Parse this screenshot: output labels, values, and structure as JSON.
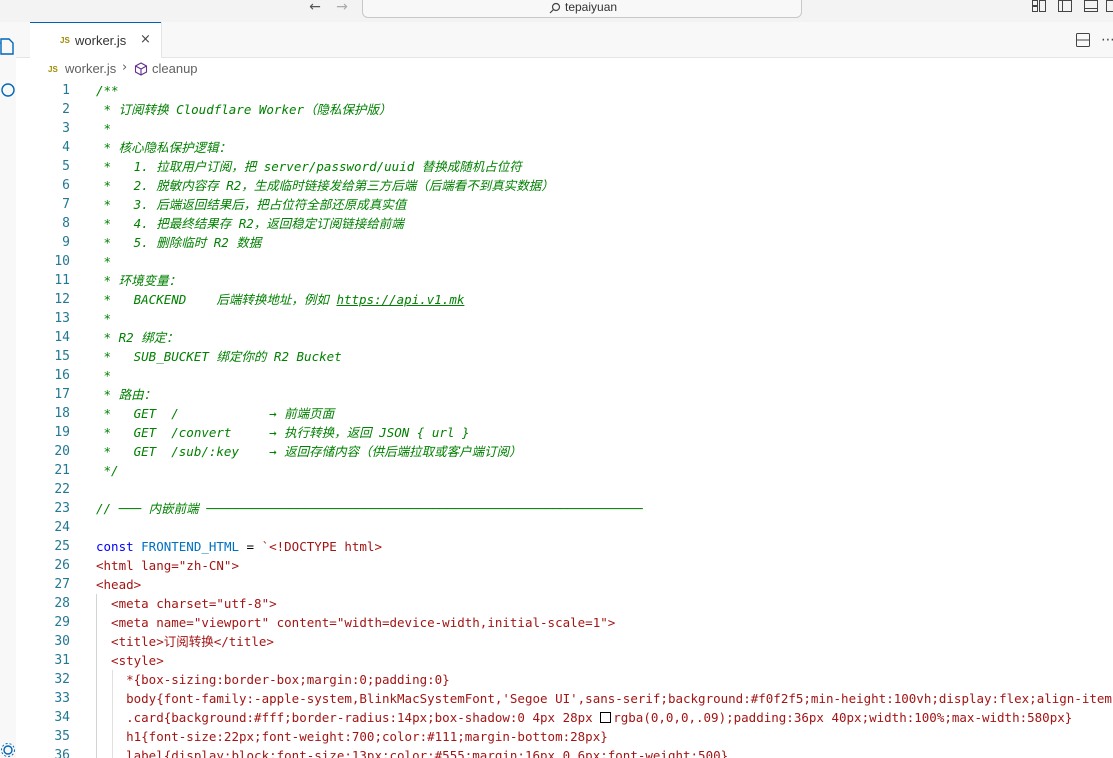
{
  "titlebar": {
    "back_icon": "arrow-left-icon",
    "forward_icon": "arrow-right-icon",
    "search_text": "tepaiyuan"
  },
  "tab": {
    "badge": "JS",
    "label": "worker.js",
    "close": "×"
  },
  "breadcrumb": {
    "badge": "JS",
    "file": "worker.js",
    "separator": "›",
    "symbol": "cleanup"
  },
  "editor": {
    "lines": [
      {
        "n": "1",
        "parts": [
          {
            "t": "/**",
            "c": "cm"
          }
        ]
      },
      {
        "n": "2",
        "parts": [
          {
            "t": " * 订阅转换 Cloudflare Worker（隐私保护版）",
            "c": "cm"
          }
        ]
      },
      {
        "n": "3",
        "parts": [
          {
            "t": " *",
            "c": "cm"
          }
        ]
      },
      {
        "n": "4",
        "parts": [
          {
            "t": " * 核心隐私保护逻辑：",
            "c": "cm"
          }
        ]
      },
      {
        "n": "5",
        "parts": [
          {
            "t": " *   1. 拉取用户订阅，把 server/password/uuid 替换成随机占位符",
            "c": "cm"
          }
        ]
      },
      {
        "n": "6",
        "parts": [
          {
            "t": " *   2. 脱敏内容存 R2，生成临时链接发给第三方后端（后端看不到真实数据）",
            "c": "cm"
          }
        ]
      },
      {
        "n": "7",
        "parts": [
          {
            "t": " *   3. 后端返回结果后，把占位符全部还原成真实值",
            "c": "cm"
          }
        ]
      },
      {
        "n": "8",
        "parts": [
          {
            "t": " *   4. 把最终结果存 R2，返回稳定订阅链接给前端",
            "c": "cm"
          }
        ]
      },
      {
        "n": "9",
        "parts": [
          {
            "t": " *   5. 删除临时 R2 数据",
            "c": "cm"
          }
        ]
      },
      {
        "n": "10",
        "parts": [
          {
            "t": " *",
            "c": "cm"
          }
        ]
      },
      {
        "n": "11",
        "parts": [
          {
            "t": " * 环境变量：",
            "c": "cm"
          }
        ]
      },
      {
        "n": "12",
        "parts": [
          {
            "t": " *   BACKEND    后端转换地址，例如 ",
            "c": "cm"
          },
          {
            "t": "https://api.v1.mk",
            "c": "cm link"
          }
        ]
      },
      {
        "n": "13",
        "parts": [
          {
            "t": " *",
            "c": "cm"
          }
        ]
      },
      {
        "n": "14",
        "parts": [
          {
            "t": " * R2 绑定：",
            "c": "cm"
          }
        ]
      },
      {
        "n": "15",
        "parts": [
          {
            "t": " *   SUB_BUCKET 绑定你的 R2 Bucket",
            "c": "cm"
          }
        ]
      },
      {
        "n": "16",
        "parts": [
          {
            "t": " *",
            "c": "cm"
          }
        ]
      },
      {
        "n": "17",
        "parts": [
          {
            "t": " * 路由：",
            "c": "cm"
          }
        ]
      },
      {
        "n": "18",
        "parts": [
          {
            "t": " *   GET  /            → 前端页面",
            "c": "cm"
          }
        ]
      },
      {
        "n": "19",
        "parts": [
          {
            "t": " *   GET  /convert     → 执行转换，返回 JSON { url }",
            "c": "cm"
          }
        ]
      },
      {
        "n": "20",
        "parts": [
          {
            "t": " *   GET  /sub/:key    → 返回存储内容（供后端拉取或客户端订阅）",
            "c": "cm"
          }
        ]
      },
      {
        "n": "21",
        "parts": [
          {
            "t": " */",
            "c": "cm"
          }
        ]
      },
      {
        "n": "22",
        "parts": []
      },
      {
        "n": "23",
        "parts": [
          {
            "t": "// ─── 内嵌前端 ──────────────────────────────────────────────────────────",
            "c": "cm"
          }
        ]
      },
      {
        "n": "24",
        "parts": []
      },
      {
        "n": "25",
        "parts": [
          {
            "t": "const ",
            "c": "kw"
          },
          {
            "t": "FRONTEND_HTML",
            "c": "var"
          },
          {
            "t": " = ",
            "c": "txt"
          },
          {
            "t": "`<!DOCTYPE html>",
            "c": "str"
          }
        ]
      },
      {
        "n": "26",
        "parts": [
          {
            "t": "<html lang=\"zh-CN\">",
            "c": "str"
          }
        ]
      },
      {
        "n": "27",
        "parts": [
          {
            "t": "<head>",
            "c": "str"
          }
        ]
      },
      {
        "n": "28",
        "parts": [
          {
            "t": "  <meta charset=\"utf-8\">",
            "c": "str"
          }
        ]
      },
      {
        "n": "29",
        "parts": [
          {
            "t": "  <meta name=\"viewport\" content=\"width=device-width,initial-scale=1\">",
            "c": "str"
          }
        ]
      },
      {
        "n": "30",
        "parts": [
          {
            "t": "  <title>订阅转换</title>",
            "c": "str"
          }
        ]
      },
      {
        "n": "31",
        "parts": [
          {
            "t": "  <style>",
            "c": "str"
          }
        ]
      },
      {
        "n": "32",
        "parts": [
          {
            "t": "    *{box-sizing:border-box;margin:0;padding:0}",
            "c": "str"
          }
        ]
      },
      {
        "n": "33",
        "parts": [
          {
            "t": "    body{font-family:-apple-system,BlinkMacSystemFont,'Segoe UI',sans-serif;background:#f0f2f5;min-height:100vh;display:flex;align-items:center",
            "c": "str"
          }
        ]
      },
      {
        "n": "34",
        "parts": [
          {
            "t": "    .card{background:#fff;border-radius:14px;box-shadow:0 4px 28px ",
            "c": "str"
          },
          {
            "t": "",
            "c": "swatch"
          },
          {
            "t": "rgba(0,0,0,.09);padding:36px 40px;width:100%;max-width:580px}",
            "c": "str"
          }
        ]
      },
      {
        "n": "35",
        "parts": [
          {
            "t": "    h1{font-size:22px;font-weight:700;color:#111;margin-bottom:28px}",
            "c": "str"
          }
        ]
      },
      {
        "n": "36",
        "parts": [
          {
            "t": "    label{display:block;font-size:13px;color:#555;margin:16px 0 6px;font-weight:500}",
            "c": "str"
          }
        ]
      }
    ]
  }
}
